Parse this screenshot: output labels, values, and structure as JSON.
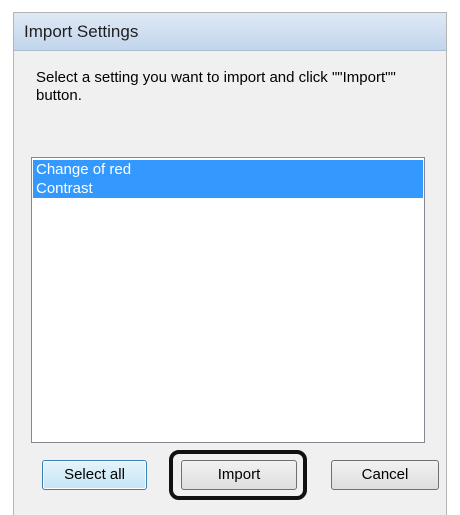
{
  "window": {
    "title": "Import Settings",
    "instructions": "Select a setting you want to import and click \"\"Import\"\" button."
  },
  "settings_list": {
    "items": [
      {
        "label": "Change of red",
        "selected": true
      },
      {
        "label": "Contrast",
        "selected": true
      }
    ],
    "selection_color": "#3399ff"
  },
  "buttons": {
    "select_all": "Select all",
    "import": "Import",
    "cancel": "Cancel"
  }
}
